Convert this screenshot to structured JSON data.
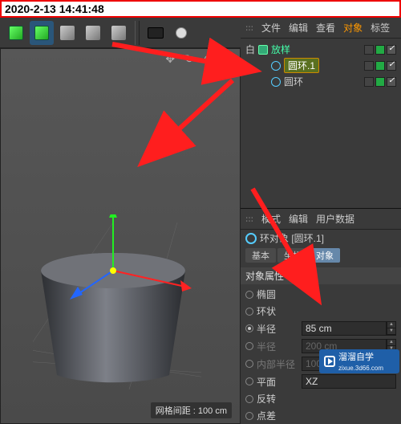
{
  "timestamp": "2020-2-13 14:41:48",
  "toolbar_icons": [
    "cube",
    "cube",
    "light",
    "light",
    "light",
    "sep",
    "camera",
    "bulb"
  ],
  "viewport": {
    "tools_glyphs": "✥ ↻ ⊕ ⊞",
    "status": "网格间距 : 100 cm"
  },
  "hierarchy_menu": {
    "grip": "꞉꞉꞉",
    "items": [
      "文件",
      "编辑",
      "查看",
      "对象",
      "标签"
    ],
    "active_index": 3
  },
  "hierarchy": {
    "root_toggle": "白",
    "root_label": "放样",
    "children": [
      {
        "label": "圆环.1",
        "selected": true
      },
      {
        "label": "圆环",
        "selected": false
      }
    ]
  },
  "attr_menu": {
    "grip": "꞉꞉꞉",
    "items": [
      "模式",
      "编辑",
      "用户数据"
    ]
  },
  "attr_header": "环对象 [圆环.1]",
  "tabs": {
    "items": [
      "基本",
      "坐标",
      "对象"
    ],
    "active_index": 2
  },
  "group_label": "对象属性",
  "props": [
    {
      "label": "椭圆",
      "type": "radio",
      "enabled": true
    },
    {
      "label": "环状",
      "type": "radio",
      "enabled": true
    },
    {
      "label": "半径",
      "type": "num",
      "value": "85 cm",
      "enabled": true
    },
    {
      "label": "半径",
      "type": "num",
      "value": "200 cm",
      "enabled": false
    },
    {
      "label": "内部半径",
      "type": "num",
      "value": "100 cm",
      "enabled": false
    },
    {
      "label": "平面",
      "type": "sel",
      "value": "XZ",
      "enabled": true
    },
    {
      "label": "反转",
      "type": "radio",
      "enabled": true
    },
    {
      "label": "点差",
      "type": "row",
      "enabled": true
    }
  ],
  "watermark": {
    "brand": "溜溜自学",
    "url": "zixue.3d66.com"
  }
}
